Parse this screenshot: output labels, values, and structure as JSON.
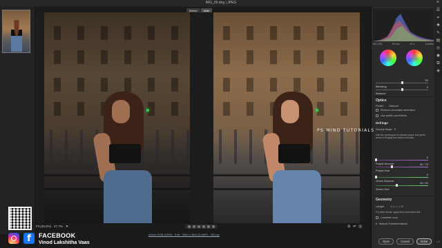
{
  "window": {
    "title": "IMG_55.dng  |  JPEG"
  },
  "compare": {
    "tabs": [
      "Before",
      "After"
    ],
    "active": "After"
  },
  "bottom": {
    "fit_label": "Fit (46.2%)",
    "zoom_value": "47.7%",
    "file_info": "Adobe RGB (1998) · 8 bit · 2560 x 3840 (9.8MP) · 300 ppi"
  },
  "panel": {
    "exif": [
      "ISO 200",
      "50 mm",
      "f/1.4",
      "1/1250s"
    ],
    "sliders_top": [
      {
        "label": "Blending",
        "value": "50",
        "level": 0.5
      },
      {
        "label": "Balance",
        "value": "0",
        "level": 0.5
      }
    ],
    "optics": {
      "header": "Optics",
      "tabs": [
        "Profile",
        "Manual"
      ],
      "checks": [
        "Remove chromatic aberration",
        "Use profile corrections"
      ],
      "defringe_header": "Defringe",
      "sample_fringe": "Sample fringe",
      "note": "Use the eyedropper to sample purple and green areas of fringing that need correction.",
      "sliders": [
        {
          "label": "Purple Amount",
          "value": "0",
          "level": 0.0,
          "color": "purple"
        },
        {
          "label": "Purple Hue",
          "value": "30 / 70",
          "level": 0.3,
          "color": "purple"
        },
        {
          "label": "Green Amount",
          "value": "0",
          "level": 0.0,
          "color": "green"
        },
        {
          "label": "Green Hue",
          "value": "40 / 60",
          "level": 0.4,
          "color": "green"
        }
      ]
    },
    "geometry": {
      "header": "Geometry",
      "upright": "Upright",
      "note": "For best results, apply lens corrections first.",
      "check": "Constrain crop",
      "manual": "Manual Transformations"
    },
    "buttons": {
      "open": "Open",
      "cancel": "Cancel",
      "done": "Done"
    }
  },
  "watermark": "PS MIND TUTORIALS",
  "social": {
    "platform": "FACEBOOK",
    "name": "Vinod Lakshitha Vaas"
  },
  "colors": {
    "panel_bg": "#2b2b2b",
    "canvas_bg": "#1c1c1c",
    "facebook": "#1877f2"
  }
}
